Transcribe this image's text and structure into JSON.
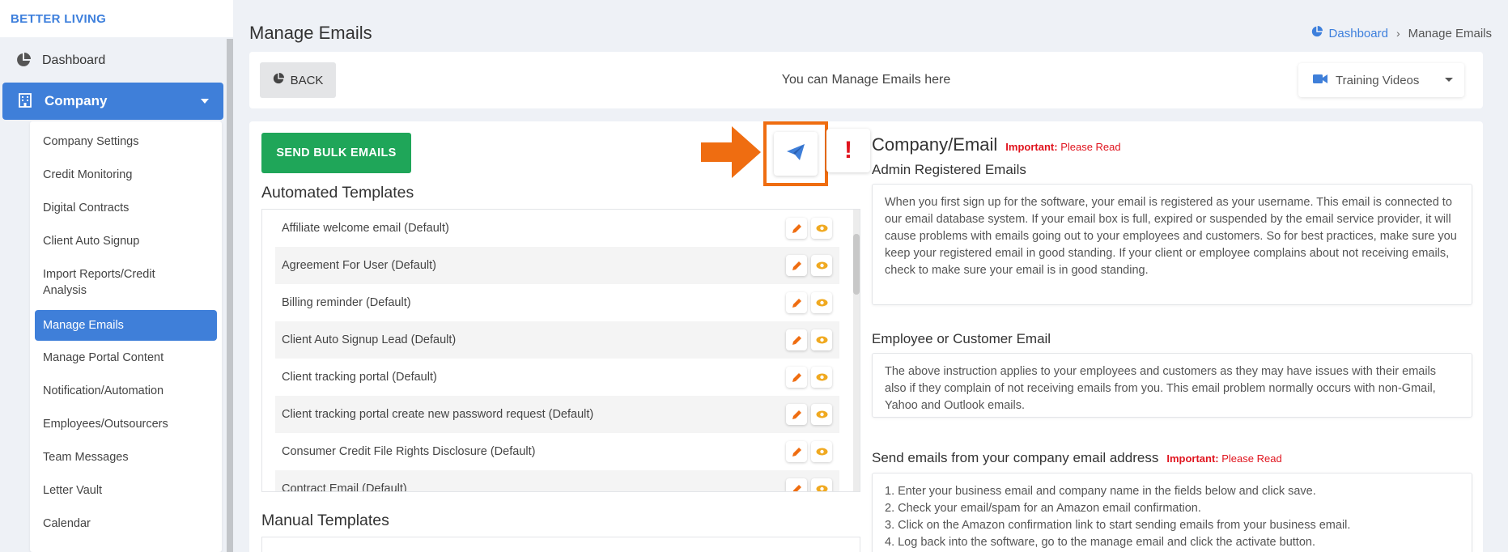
{
  "brand": "BETTER LIVING",
  "nav": {
    "dashboard": "Dashboard",
    "company": "Company",
    "submenu": [
      {
        "label": "Company Settings",
        "active": false
      },
      {
        "label": "Credit Monitoring",
        "active": false
      },
      {
        "label": "Digital Contracts",
        "active": false
      },
      {
        "label": "Client Auto Signup",
        "active": false
      },
      {
        "label": "Import Reports/Credit Analysis",
        "active": false
      },
      {
        "label": "Manage Emails",
        "active": true
      },
      {
        "label": "Manage Portal Content",
        "active": false
      },
      {
        "label": "Notification/Automation",
        "active": false
      },
      {
        "label": "Employees/Outsourcers",
        "active": false
      },
      {
        "label": "Team Messages",
        "active": false
      },
      {
        "label": "Letter Vault",
        "active": false
      },
      {
        "label": "Calendar",
        "active": false
      }
    ]
  },
  "page": {
    "title": "Manage Emails",
    "breadcrumb": {
      "home": "Dashboard",
      "current": "Manage Emails"
    }
  },
  "topbar": {
    "back": "BACK",
    "message": "You can Manage Emails here",
    "training": "Training Videos"
  },
  "main": {
    "bulk_button": "SEND BULK EMAILS",
    "automated_title": "Automated Templates",
    "templates": [
      "Affiliate welcome email (Default)",
      "Agreement For User (Default)",
      "Billing reminder (Default)",
      "Client Auto Signup Lead (Default)",
      "Client tracking portal (Default)",
      "Client tracking portal create new password request (Default)",
      "Consumer Credit File Rights Disclosure (Default)",
      "Contract Email (Default)"
    ],
    "manual_title": "Manual Templates"
  },
  "right": {
    "title": "Company/Email",
    "important_label": "Important:",
    "important_text": "Please Read",
    "admin_title": "Admin Registered Emails",
    "admin_text": "When you first sign up for the software, your email is registered as your username. This email is connected to our email database system. If your email box is full, expired or suspended by the email service provider, it will cause problems with emails going out to your employees and customers. So for best practices, make sure you keep your registered email in good standing. If your client or employee complains about not receiving emails, check to make sure your email is in good standing.",
    "employee_title": "Employee or Customer Email",
    "employee_text": "The above instruction applies to your employees and customers as they may have issues with their emails also if they complain of not receiving emails from you. This email problem normally occurs with non-Gmail, Yahoo and Outlook emails.",
    "send_title": "Send emails from your company email address",
    "steps": [
      "1. Enter your business email and company name in the fields below and click save.",
      "2. Check your email/spam for an Amazon email confirmation.",
      "3. Click on the Amazon confirmation link to start sending emails from your business email.",
      "4. Log back into the software, go to the manage email and click the activate button."
    ]
  },
  "colors": {
    "primary": "#3f7fd9",
    "success": "#1fa659",
    "highlight": "#ef6d11",
    "danger": "#e0141e"
  },
  "icons": {
    "dashboard": "pie-chart-icon",
    "company": "building-icon",
    "send": "paper-plane-icon",
    "warn": "exclamation-icon",
    "edit": "pencil-icon",
    "view": "eye-icon",
    "training": "video-camera-icon"
  }
}
